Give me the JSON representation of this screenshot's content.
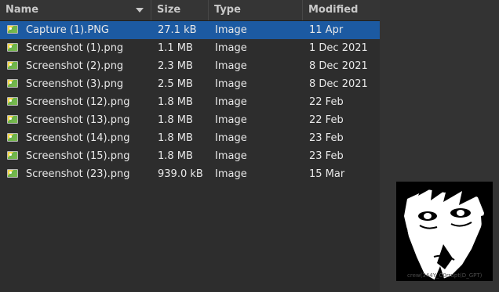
{
  "columns": {
    "name": "Name",
    "size": "Size",
    "type": "Type",
    "modified": "Modified"
  },
  "files": [
    {
      "name": "Capture (1).PNG",
      "size": "27.1 kB",
      "type": "Image",
      "modified": "11 Apr",
      "selected": true
    },
    {
      "name": "Screenshot (1).png",
      "size": "1.1 MB",
      "type": "Image",
      "modified": "1 Dec 2021"
    },
    {
      "name": "Screenshot (2).png",
      "size": "2.3 MB",
      "type": "Image",
      "modified": "8 Dec 2021"
    },
    {
      "name": "Screenshot (3).png",
      "size": "2.5 MB",
      "type": "Image",
      "modified": "8 Dec 2021"
    },
    {
      "name": "Screenshot (12).png",
      "size": "1.8 MB",
      "type": "Image",
      "modified": "22 Feb"
    },
    {
      "name": "Screenshot (13).png",
      "size": "1.8 MB",
      "type": "Image",
      "modified": "22 Feb"
    },
    {
      "name": "Screenshot (14).png",
      "size": "1.8 MB",
      "type": "Image",
      "modified": "23 Feb"
    },
    {
      "name": "Screenshot (15).png",
      "size": "1.8 MB",
      "type": "Image",
      "modified": "23 Feb"
    },
    {
      "name": "Screenshot (23).png",
      "size": "939.0 kB",
      "type": "Image",
      "modified": "15 Mar"
    }
  ],
  "preview": {
    "caption": "crew(344Y_C0rrupt(D_GPT)"
  },
  "icons": {
    "file": "image-file-icon",
    "sort": "sort-descending-icon"
  },
  "colors": {
    "selection": "#1c5aa2",
    "background": "#2d2d2d"
  }
}
